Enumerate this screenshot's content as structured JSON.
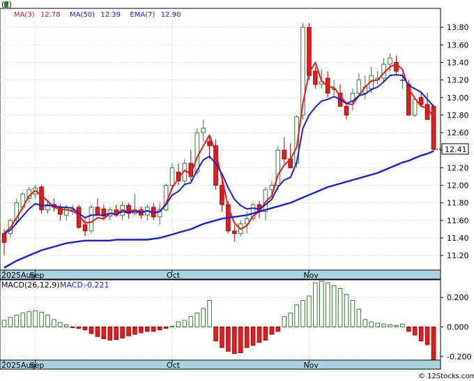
{
  "chart_data": [
    {
      "type": "candlestick",
      "title": "(F)",
      "legend": [
        {
          "label": "MA(3)",
          "value": "12.78",
          "color": "#e81818"
        },
        {
          "label": "MA(50)",
          "value": "12.39",
          "color": "#1c1cd6"
        },
        {
          "label": "EMA(7)",
          "value": "12.90",
          "color": "#1c1cd6"
        }
      ],
      "y_ticks": [
        "13.80",
        "13.60",
        "13.40",
        "13.20",
        "13.00",
        "12.80",
        "12.60",
        "12.40",
        "12.20",
        "12.00",
        "11.80",
        "11.60",
        "11.40",
        "11.20"
      ],
      "ylim": [
        11.05,
        14.0
      ],
      "x_labels": [
        {
          "text": "2025Aug",
          "index": 0
        },
        {
          "text": "Sep",
          "index": 5
        },
        {
          "text": "Oct",
          "index": 27
        },
        {
          "text": "Nov",
          "index": 49
        }
      ],
      "last_price": "12.41",
      "last_price_value": 12.41,
      "candles": [
        [
          11.45,
          11.5,
          11.2,
          11.35
        ],
        [
          11.45,
          11.62,
          11.4,
          11.6
        ],
        [
          11.6,
          11.85,
          11.55,
          11.8
        ],
        [
          11.75,
          11.92,
          11.72,
          11.9
        ],
        [
          11.85,
          11.98,
          11.8,
          11.95
        ],
        [
          11.9,
          12.0,
          11.85,
          11.97
        ],
        [
          11.98,
          12.0,
          11.68,
          11.72
        ],
        [
          11.72,
          11.82,
          11.68,
          11.78
        ],
        [
          11.78,
          11.85,
          11.7,
          11.75
        ],
        [
          11.75,
          11.78,
          11.6,
          11.67
        ],
        [
          11.66,
          11.78,
          11.6,
          11.74
        ],
        [
          11.7,
          11.78,
          11.66,
          11.72
        ],
        [
          11.75,
          11.78,
          11.5,
          11.52
        ],
        [
          11.55,
          11.62,
          11.42,
          11.48
        ],
        [
          11.48,
          11.78,
          11.45,
          11.75
        ],
        [
          11.75,
          11.85,
          11.68,
          11.67
        ],
        [
          11.73,
          11.78,
          11.6,
          11.65
        ],
        [
          11.65,
          11.75,
          11.6,
          11.72
        ],
        [
          11.72,
          11.78,
          11.64,
          11.66
        ],
        [
          11.66,
          11.82,
          11.6,
          11.77
        ],
        [
          11.77,
          11.8,
          11.62,
          11.68
        ],
        [
          11.68,
          11.9,
          11.66,
          11.72
        ],
        [
          11.72,
          11.76,
          11.62,
          11.66
        ],
        [
          11.66,
          11.78,
          11.6,
          11.75
        ],
        [
          11.75,
          11.8,
          11.6,
          11.64
        ],
        [
          11.64,
          11.8,
          11.55,
          11.72
        ],
        [
          11.72,
          12.02,
          11.7,
          12.0
        ],
        [
          12.0,
          12.25,
          11.95,
          12.2
        ],
        [
          12.15,
          12.25,
          12.0,
          12.05
        ],
        [
          12.05,
          12.3,
          12.0,
          12.25
        ],
        [
          12.25,
          12.4,
          12.05,
          12.1
        ],
        [
          12.15,
          12.65,
          12.12,
          12.6
        ],
        [
          12.6,
          12.75,
          12.5,
          12.65
        ],
        [
          12.5,
          12.55,
          12.3,
          12.45
        ],
        [
          12.45,
          12.52,
          11.95,
          12.0
        ],
        [
          12.0,
          12.1,
          11.7,
          11.78
        ],
        [
          11.78,
          11.82,
          11.45,
          11.48
        ],
        [
          11.48,
          11.55,
          11.36,
          11.45
        ],
        [
          11.45,
          11.6,
          11.42,
          11.56
        ],
        [
          11.56,
          11.7,
          11.45,
          11.62
        ],
        [
          11.62,
          11.8,
          11.6,
          11.78
        ],
        [
          11.78,
          11.82,
          11.62,
          11.7
        ],
        [
          11.7,
          11.98,
          11.6,
          11.95
        ],
        [
          11.95,
          12.05,
          11.88,
          12.0
        ],
        [
          12.0,
          12.45,
          11.95,
          12.4
        ],
        [
          12.4,
          12.55,
          12.25,
          12.3
        ],
        [
          12.3,
          12.48,
          12.2,
          12.2
        ],
        [
          12.25,
          12.8,
          12.2,
          12.78
        ],
        [
          12.8,
          13.85,
          12.75,
          13.8
        ],
        [
          13.8,
          13.85,
          13.2,
          13.25
        ],
        [
          13.3,
          13.35,
          13.1,
          13.15
        ],
        [
          13.15,
          13.32,
          13.1,
          13.18
        ],
        [
          13.22,
          13.3,
          13.0,
          13.05
        ],
        [
          13.1,
          13.2,
          13.0,
          13.1
        ],
        [
          13.05,
          13.15,
          12.9,
          12.9
        ],
        [
          12.9,
          12.95,
          12.75,
          12.8
        ],
        [
          12.95,
          13.1,
          12.85,
          13.05
        ],
        [
          13.05,
          13.28,
          13.0,
          13.2
        ],
        [
          13.05,
          13.25,
          12.98,
          13.12
        ],
        [
          13.1,
          13.35,
          13.05,
          13.25
        ],
        [
          13.2,
          13.3,
          13.15,
          13.22
        ],
        [
          13.22,
          13.45,
          13.18,
          13.38
        ],
        [
          13.38,
          13.5,
          13.3,
          13.45
        ],
        [
          13.4,
          13.48,
          13.25,
          13.3
        ],
        [
          13.2,
          13.28,
          13.1,
          13.2
        ],
        [
          13.15,
          13.2,
          12.95,
          12.8
        ],
        [
          12.8,
          13.0,
          12.78,
          12.98
        ],
        [
          13.0,
          13.05,
          12.9,
          12.92
        ],
        [
          12.92,
          13.05,
          12.85,
          12.75
        ],
        [
          12.9,
          12.92,
          12.38,
          12.41
        ]
      ],
      "ma3": [
        11.45,
        11.52,
        11.63,
        11.75,
        11.88,
        11.94,
        11.88,
        11.82,
        11.75,
        11.73,
        11.72,
        11.71,
        11.66,
        11.57,
        11.58,
        11.63,
        11.62,
        11.68,
        11.68,
        11.72,
        11.7,
        11.72,
        11.69,
        11.71,
        11.68,
        11.7,
        11.79,
        11.97,
        12.08,
        12.17,
        12.13,
        12.32,
        12.45,
        12.57,
        12.37,
        12.08,
        11.75,
        11.57,
        11.5,
        11.54,
        11.65,
        11.7,
        11.81,
        11.88,
        12.12,
        12.23,
        12.3,
        12.43,
        12.93,
        13.28,
        13.4,
        13.19,
        13.13,
        13.11,
        13.02,
        12.93,
        12.92,
        13.02,
        13.12,
        13.19,
        13.2,
        13.28,
        13.35,
        13.38,
        13.32,
        13.1,
        12.99,
        12.9,
        12.88,
        12.78
      ],
      "ema7": [
        11.45,
        11.49,
        11.57,
        11.65,
        11.73,
        11.79,
        11.77,
        11.77,
        11.77,
        11.75,
        11.75,
        11.74,
        11.68,
        11.63,
        11.66,
        11.66,
        11.66,
        11.68,
        11.67,
        11.7,
        11.69,
        11.7,
        11.69,
        11.71,
        11.69,
        11.7,
        11.78,
        11.89,
        11.93,
        12.01,
        12.03,
        12.17,
        12.29,
        12.33,
        12.25,
        12.13,
        11.97,
        11.84,
        11.77,
        11.73,
        11.74,
        11.73,
        11.78,
        11.84,
        11.98,
        12.06,
        12.09,
        12.26,
        12.65,
        12.8,
        12.89,
        12.96,
        12.98,
        13.01,
        12.98,
        12.93,
        12.96,
        13.02,
        13.04,
        13.09,
        13.12,
        13.18,
        13.25,
        13.26,
        13.25,
        13.14,
        13.1,
        13.06,
        12.98,
        12.9
      ],
      "ma50": [
        11.06,
        11.1,
        11.14,
        11.17,
        11.2,
        11.23,
        11.26,
        11.28,
        11.3,
        11.32,
        11.34,
        11.35,
        11.36,
        11.37,
        11.37,
        11.37,
        11.37,
        11.37,
        11.38,
        11.38,
        11.38,
        11.38,
        11.38,
        11.38,
        11.39,
        11.4,
        11.42,
        11.44,
        11.46,
        11.48,
        11.5,
        11.53,
        11.56,
        11.58,
        11.6,
        11.62,
        11.63,
        11.64,
        11.65,
        11.66,
        11.68,
        11.7,
        11.72,
        11.74,
        11.76,
        11.78,
        11.8,
        11.83,
        11.86,
        11.89,
        11.92,
        11.95,
        11.98,
        12.0,
        12.02,
        12.04,
        12.06,
        12.08,
        12.1,
        12.12,
        12.14,
        12.17,
        12.2,
        12.23,
        12.26,
        12.28,
        12.31,
        12.34,
        12.36,
        12.39
      ]
    },
    {
      "type": "bar",
      "title": "MACD(26,12,9)",
      "value_label": "MACD:",
      "value": "-0.221",
      "y_ticks": [
        "0.200",
        "0.000",
        "-0.200"
      ],
      "ylim": [
        -0.22,
        0.31
      ],
      "x_labels": [
        {
          "text": "2025Aug",
          "index": 0
        },
        {
          "text": "Sep",
          "index": 5
        },
        {
          "text": "Oct",
          "index": 27
        },
        {
          "text": "Nov",
          "index": 49
        }
      ],
      "values": [
        0.045,
        0.065,
        0.08,
        0.095,
        0.105,
        0.11,
        0.1,
        0.08,
        0.05,
        0.03,
        0.015,
        -0.005,
        -0.01,
        -0.02,
        -0.045,
        -0.065,
        -0.08,
        -0.09,
        -0.085,
        -0.075,
        -0.06,
        -0.05,
        -0.04,
        -0.03,
        -0.03,
        -0.02,
        -0.01,
        0.005,
        0.035,
        0.045,
        0.07,
        0.095,
        0.125,
        0.18,
        -0.095,
        -0.14,
        -0.165,
        -0.18,
        -0.175,
        -0.14,
        -0.125,
        -0.105,
        -0.09,
        -0.05,
        -0.03,
        0.07,
        0.095,
        0.15,
        0.18,
        0.21,
        0.3,
        0.31,
        0.3,
        0.28,
        0.26,
        0.22,
        0.18,
        0.12,
        0.05,
        0.035,
        0.025,
        0.02,
        0.015,
        0.01,
        0.02,
        -0.03,
        -0.055,
        -0.095,
        -0.12,
        -0.221
      ]
    }
  ],
  "watermark": "© 12Stocks.com"
}
